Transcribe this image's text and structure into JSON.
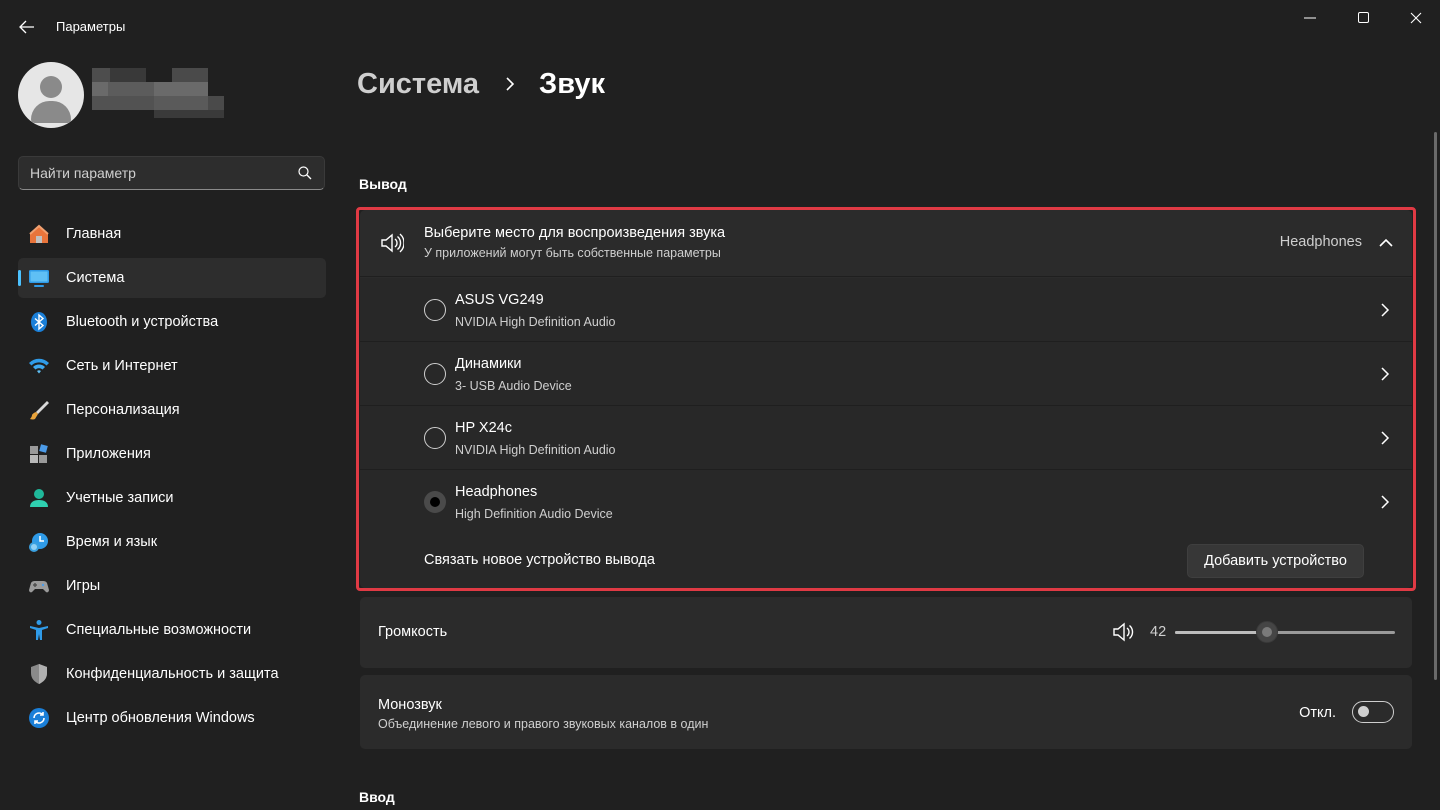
{
  "window": {
    "title": "Параметры",
    "controls": [
      "minimize-icon",
      "maximize-icon",
      "close-icon"
    ]
  },
  "search": {
    "placeholder": "Найти параметр"
  },
  "sidebar": {
    "items": [
      {
        "label": "Главная",
        "icon": "home-icon"
      },
      {
        "label": "Система",
        "icon": "system-icon",
        "active": true
      },
      {
        "label": "Bluetooth и устройства",
        "icon": "bluetooth-icon"
      },
      {
        "label": "Сеть и Интернет",
        "icon": "wifi-icon"
      },
      {
        "label": "Персонализация",
        "icon": "brush-icon"
      },
      {
        "label": "Приложения",
        "icon": "apps-icon"
      },
      {
        "label": "Учетные записи",
        "icon": "account-icon"
      },
      {
        "label": "Время и язык",
        "icon": "time-language-icon"
      },
      {
        "label": "Игры",
        "icon": "gamepad-icon"
      },
      {
        "label": "Специальные возможности",
        "icon": "accessibility-icon"
      },
      {
        "label": "Конфиденциальность и защита",
        "icon": "shield-icon"
      },
      {
        "label": "Центр обновления Windows",
        "icon": "update-icon"
      }
    ]
  },
  "breadcrumb": {
    "parent": "Система",
    "current": "Звук"
  },
  "output": {
    "section_title": "Вывод",
    "header": {
      "title": "Выберите место для воспроизведения звука",
      "subtitle": "У приложений могут быть собственные параметры",
      "selected": "Headphones"
    },
    "devices": [
      {
        "name": "ASUS VG249",
        "description": "NVIDIA High Definition Audio",
        "selected": false
      },
      {
        "name": "Динамики",
        "description": "3- USB Audio Device",
        "selected": false
      },
      {
        "name": "HP X24c",
        "description": "NVIDIA High Definition Audio",
        "selected": false
      },
      {
        "name": "Headphones",
        "description": "High Definition Audio Device",
        "selected": true
      }
    ],
    "pair_label": "Связать новое устройство вывода",
    "add_button": "Добавить устройство"
  },
  "volume": {
    "label": "Громкость",
    "value": "42",
    "level": 0.42
  },
  "mono": {
    "title": "Монозвук",
    "subtitle": "Объединение левого и правого звуковых каналов в один",
    "state": "Откл."
  },
  "input": {
    "section_title": "Ввод"
  },
  "colors": {
    "background": "#202020",
    "card": "#2b2b2b",
    "accent": "#4cc2ff",
    "highlight": "#e03a44"
  }
}
